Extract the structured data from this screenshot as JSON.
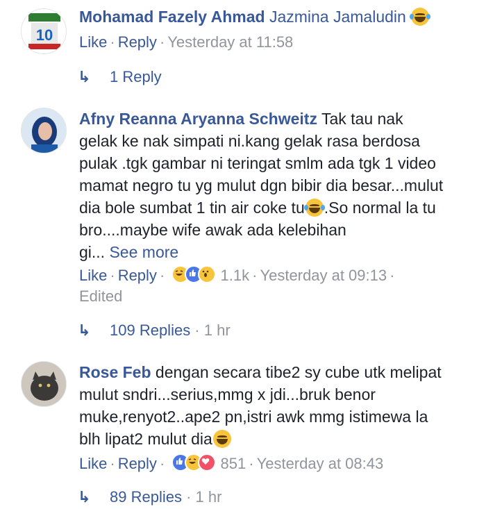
{
  "comments": [
    {
      "author": "Mohamad Fazely Ahmad",
      "tagged": "Jazmina Jamaludin",
      "like": "Like",
      "reply": "Reply",
      "time": "Yesterday at 11:58",
      "replies": {
        "label": "1 Reply",
        "time": ""
      }
    },
    {
      "author": "Afny Reanna Aryanna Schweitz",
      "lines": [
        "Tak tau nak",
        "gelak ke nak simpati ni.kang gelak rasa berdosa",
        "pulak .tgk gambar ni teringat smlm ada tgk 1 video",
        "mamat negro tu yg mulut dgn bibir dia besar...mulut",
        "dia bole sumbat 1 tin air coke tu",
        ".So normal la tu",
        "bro....maybe wife awak ada kelebihan",
        "gi...",
        "See more"
      ],
      "like": "Like",
      "reply": "Reply",
      "reaction_count": "1.1k",
      "time": "Yesterday at 09:13",
      "edited": "Edited",
      "replies": {
        "label": "109 Replies",
        "time": "1 hr"
      }
    },
    {
      "author": "Rose Feb",
      "lines": [
        "dengan secara tibe2 sy cube utk melipat",
        "mulut sndri...serius,mmg x jdi...bruk benor",
        "muke,renyot2..ape2 pn,istri awk mmg istimewa la",
        "blh lipat2 mulut dia"
      ],
      "like": "Like",
      "reply": "Reply",
      "reaction_count": "851",
      "time": "Yesterday at 08:43",
      "replies": {
        "label": "89 Replies",
        "time": "1 hr"
      }
    }
  ],
  "icons": {
    "reply_arrow": "reply-arrow-icon",
    "laugh_emoji": "laughing-emoji-icon",
    "grin_emoji": "grinning-emoji-icon"
  },
  "colors": {
    "link": "#385898",
    "meta": "#90949c",
    "text": "#1d2129"
  }
}
